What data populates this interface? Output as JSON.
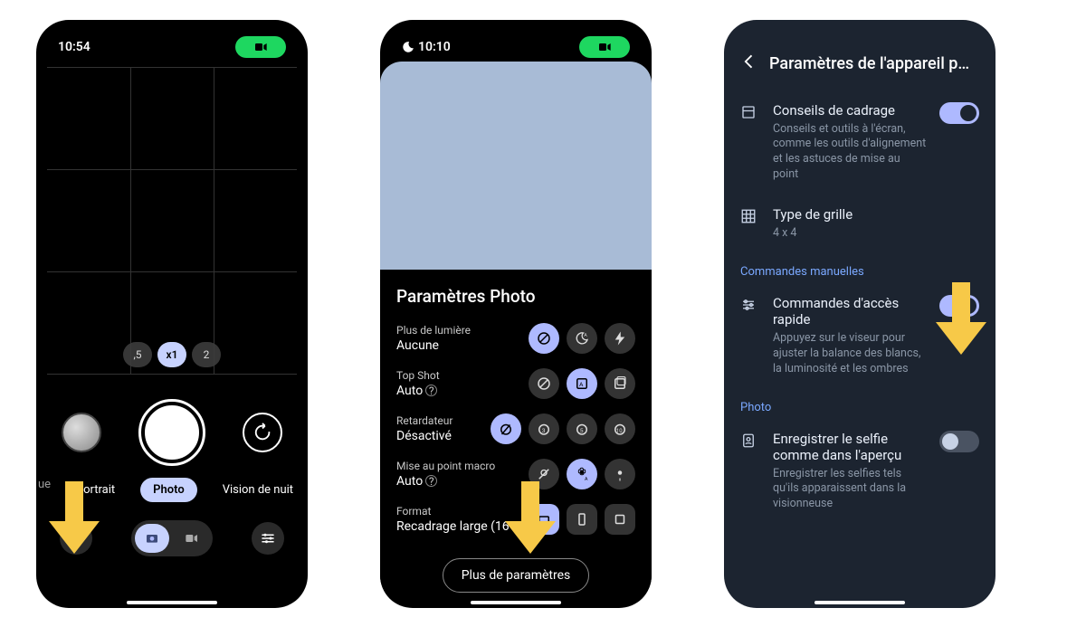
{
  "phone1": {
    "time": "10:54",
    "zoom": {
      "opts": [
        ",5",
        "x1",
        "2"
      ],
      "selected": 1
    },
    "modes": {
      "left": "Portrait",
      "center": "Photo",
      "right": "Vision de nuit",
      "far_left_clip": "ue"
    }
  },
  "phone2": {
    "time": "10:10",
    "panel_title": "Paramètres Photo",
    "rows": {
      "light": {
        "label": "Plus de lumière",
        "value": "Aucune"
      },
      "topshot": {
        "label": "Top Shot",
        "value": "Auto"
      },
      "timer": {
        "label": "Retardateur",
        "value": "Désactivé"
      },
      "macro": {
        "label": "Mise au point macro",
        "value": "Auto"
      },
      "format": {
        "label": "Format",
        "value": "Recadrage large (16"
      }
    },
    "more_button": "Plus de paramètres"
  },
  "phone3": {
    "title": "Paramètres de l'appareil p…",
    "framing": {
      "title": "Conseils de cadrage",
      "sub": "Conseils et outils à l'écran, comme les outils d'alignement et les astuces de mise au point"
    },
    "grid": {
      "title": "Type de grille",
      "sub": "4 x 4"
    },
    "section_manual": "Commandes manuelles",
    "quick": {
      "title": "Commandes d'accès rapide",
      "sub": "Appuyez sur le viseur pour ajuster la balance des blancs, la luminosité et les ombres"
    },
    "section_photo": "Photo",
    "selfie": {
      "title": "Enregistrer le selfie comme dans l'aperçu",
      "sub": "Enregistrer les selfies tels qu'ils apparaissent dans la visionneuse"
    }
  }
}
